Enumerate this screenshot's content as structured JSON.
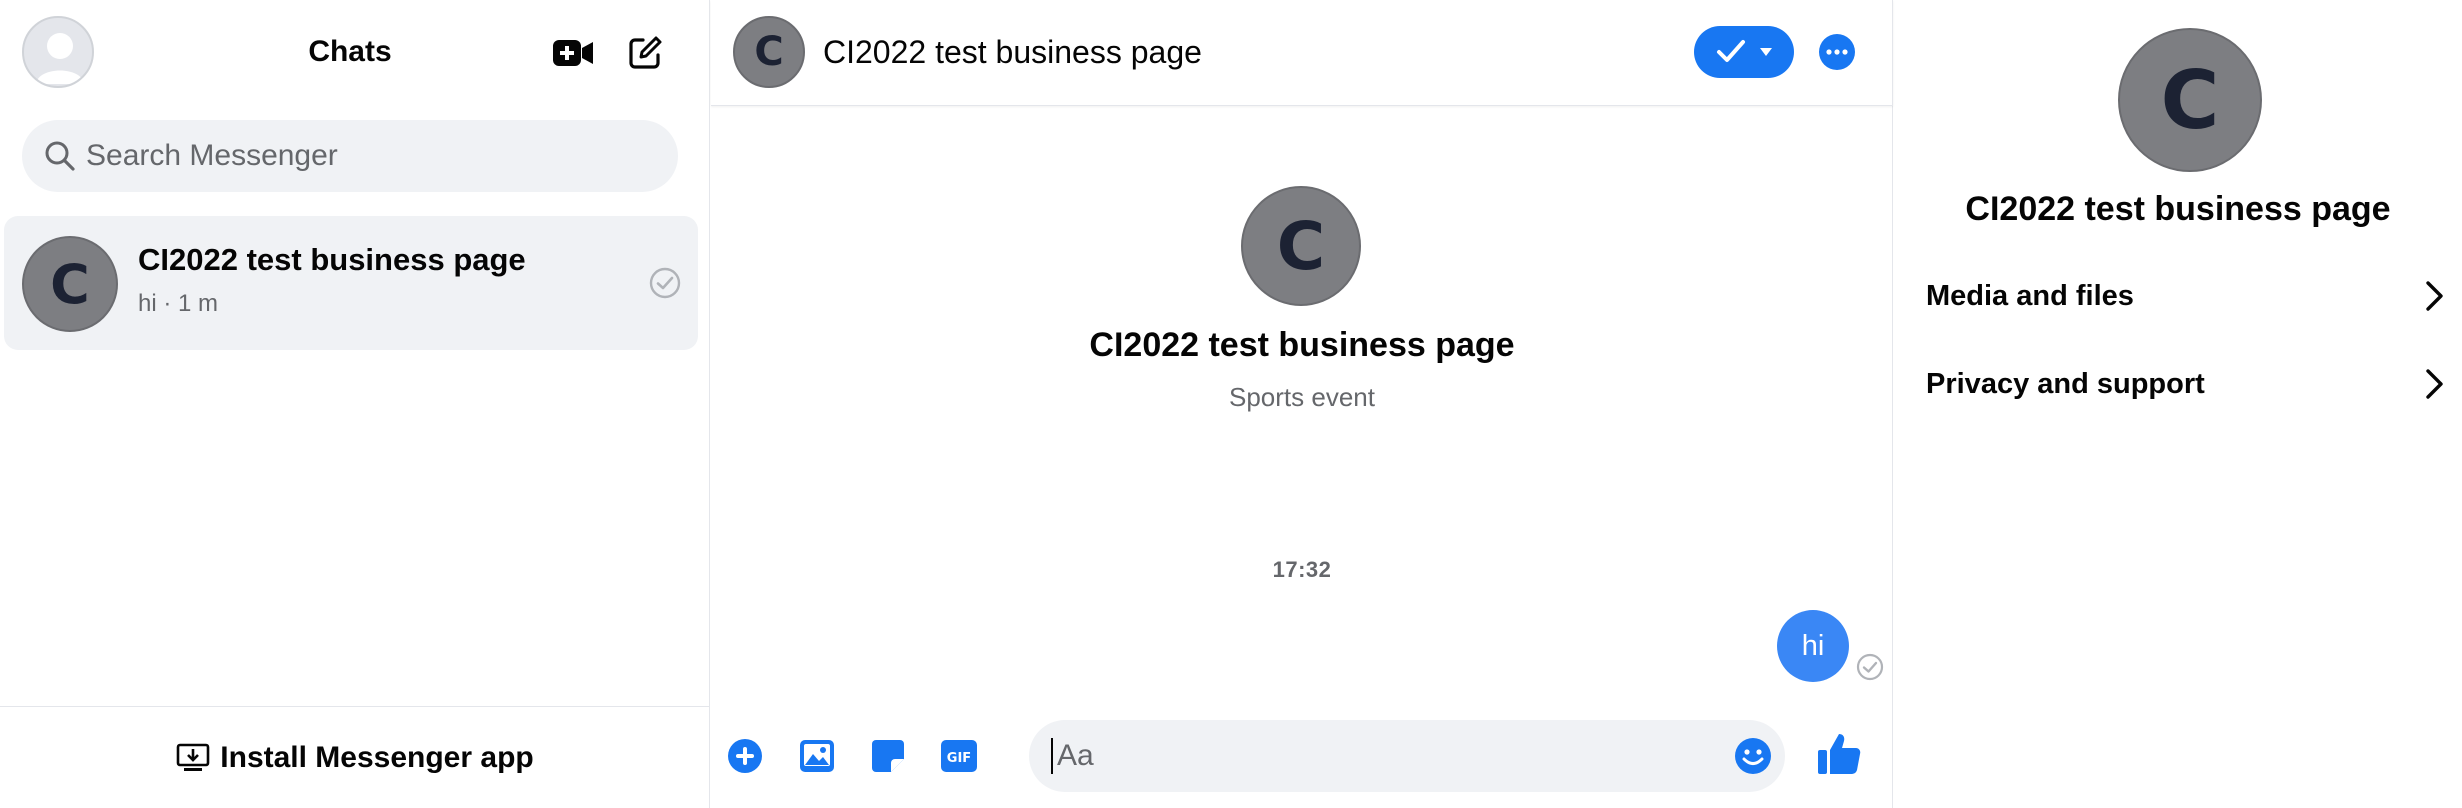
{
  "left": {
    "title": "Chats",
    "search": {
      "placeholder": "Search Messenger"
    },
    "conversations": [
      {
        "name": "CI2022 test business page",
        "avatar_letter": "C",
        "preview": "hi · 1 m"
      }
    ],
    "footer": {
      "label": "Install Messenger app"
    }
  },
  "middle": {
    "header": {
      "title": "CI2022 test business page",
      "avatar_letter": "C"
    },
    "intro": {
      "avatar_letter": "C",
      "name": "CI2022 test business page",
      "subtitle": "Sports event"
    },
    "timestamp": "17:32",
    "messages": [
      {
        "text": "hi",
        "from": "me"
      }
    ],
    "composer": {
      "placeholder": "Aa"
    }
  },
  "right": {
    "avatar_letter": "C",
    "name": "CI2022 test business page",
    "rows": [
      {
        "label": "Media and files"
      },
      {
        "label": "Privacy and support"
      }
    ]
  },
  "colors": {
    "accent": "#1877f2",
    "bubble": "#3a87f5",
    "avatar_bg": "#7d7e82",
    "panel_bg": "#f0f2f5"
  },
  "icons": [
    "video-call-icon",
    "compose-icon",
    "search-icon",
    "check-circle-icon",
    "desktop-download-icon",
    "checkmark-icon",
    "dropdown-caret-icon",
    "more-icon",
    "plus-icon",
    "image-icon",
    "sticker-icon",
    "gif-icon",
    "emoji-icon",
    "thumbs-up-icon",
    "chevron-right-icon"
  ]
}
